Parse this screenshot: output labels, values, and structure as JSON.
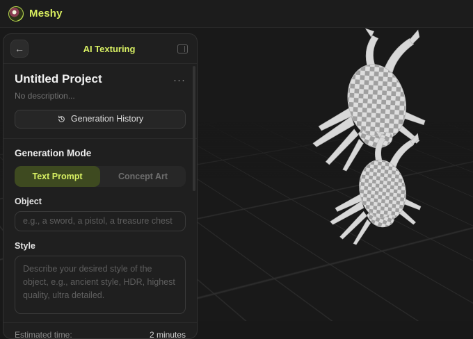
{
  "topbar": {
    "brand": "Meshy"
  },
  "sidebar": {
    "header": {
      "back_icon_glyph": "←",
      "title": "AI Texturing"
    },
    "project": {
      "title": "Untitled Project",
      "menu_glyph": "···",
      "description": "No description..."
    },
    "history_button_label": "Generation History",
    "generation_mode": {
      "label": "Generation Mode",
      "tabs": [
        {
          "label": "Text Prompt",
          "active": true
        },
        {
          "label": "Concept Art",
          "active": false
        }
      ]
    },
    "object_field": {
      "label": "Object",
      "placeholder": "e.g., a sword, a pistol, a treasure chest"
    },
    "style_field": {
      "label": "Style",
      "placeholder": "Describe your desired style of the object, e.g., ancient style, HDR, highest quality, ultra detailed."
    },
    "footer": {
      "label": "Estimated time:",
      "value": "2 minutes"
    }
  },
  "viewport": {
    "models": [
      "crab-checker-model-top",
      "crab-checker-model-bottom"
    ]
  },
  "colors": {
    "accent": "#d8f063",
    "active_tab_bg": "#3e4a20",
    "sidebar_bg": "#1f1f1f",
    "viewport_bg": "#191919",
    "grid_line": "#2e2e2e"
  }
}
